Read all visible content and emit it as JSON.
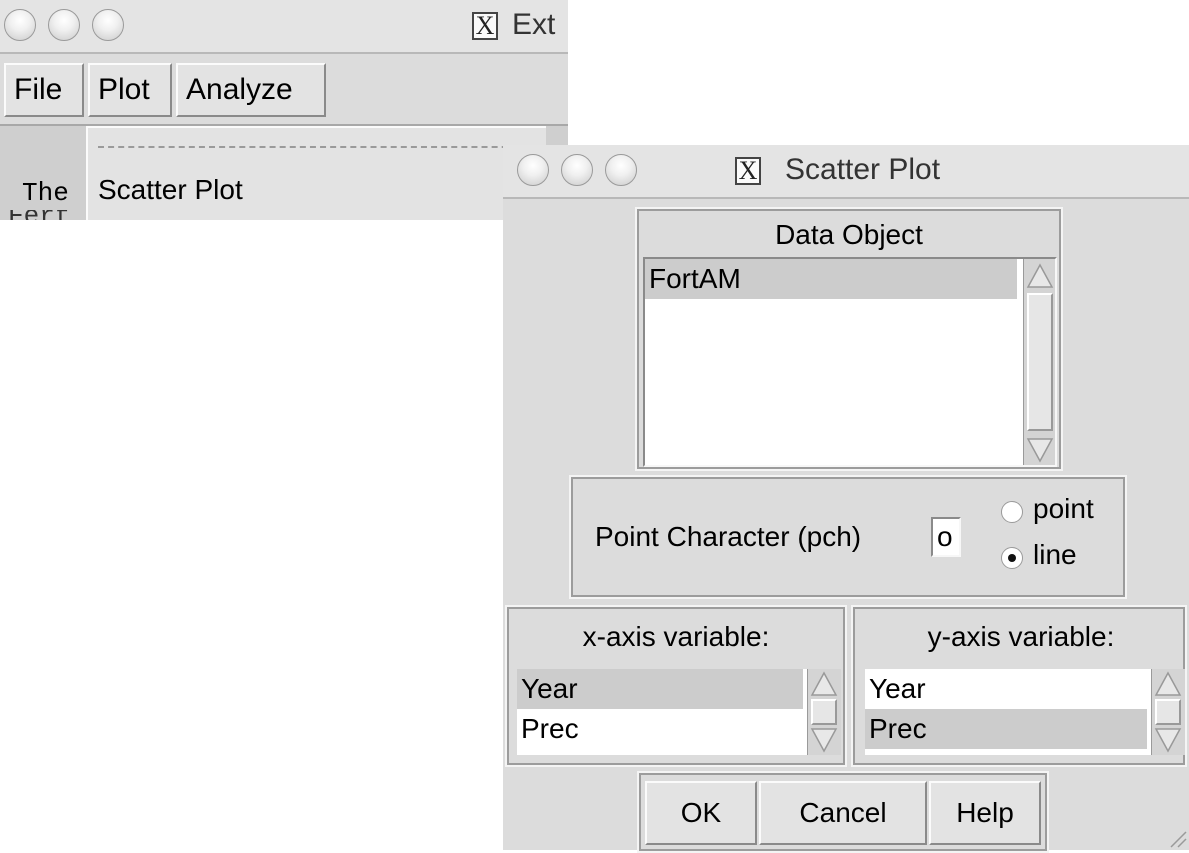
{
  "background_window": {
    "title": "Ext",
    "menu": {
      "file": "File",
      "plot": "Plot",
      "analyze": "Analyze"
    },
    "dropdown": {
      "items": [
        "Scatter Plot"
      ]
    },
    "body_text": "The",
    "body_text_partial": "Fertil"
  },
  "dialog": {
    "title": "Scatter Plot",
    "data_object": {
      "label": "Data Object",
      "items": [
        {
          "label": "FortAM",
          "selected": true
        }
      ]
    },
    "point_character": {
      "label": "Point Character (pch)",
      "value": "o",
      "options": [
        {
          "label": "point",
          "selected": false
        },
        {
          "label": "line",
          "selected": true
        }
      ]
    },
    "x_axis": {
      "label": "x-axis variable:",
      "items": [
        {
          "label": "Year",
          "selected": true
        },
        {
          "label": "Prec",
          "selected": false
        }
      ]
    },
    "y_axis": {
      "label": "y-axis variable:",
      "items": [
        {
          "label": "Year",
          "selected": false
        },
        {
          "label": "Prec",
          "selected": true
        }
      ]
    },
    "buttons": {
      "ok": "OK",
      "cancel": "Cancel",
      "help": "Help"
    }
  },
  "icons": {
    "window_buttons": "traffic-light-icon",
    "x11": "x11-icon",
    "scroll_up": "scroll-up-arrow-icon",
    "scroll_down": "scroll-down-arrow-icon",
    "resize": "resize-grip-icon"
  }
}
